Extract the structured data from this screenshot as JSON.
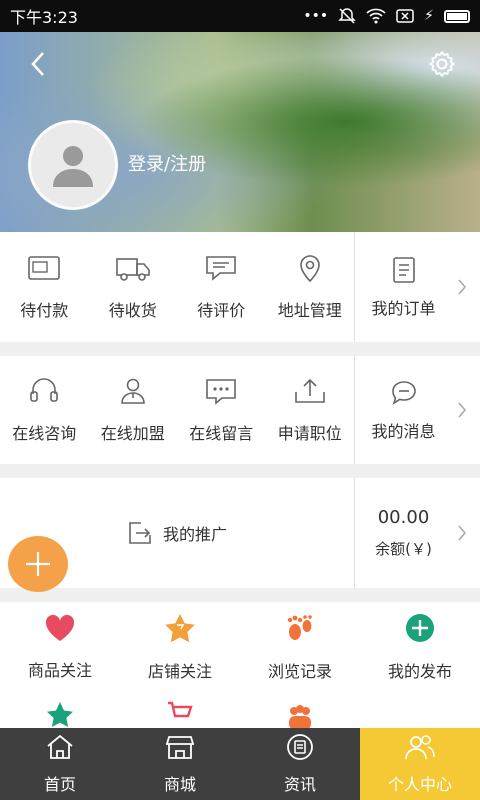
{
  "status_bar": {
    "time": "下午3:23"
  },
  "header": {
    "login_text": "登录/注册"
  },
  "orders": {
    "items": [
      {
        "label": "待付款",
        "icon": "wallet-icon"
      },
      {
        "label": "待收货",
        "icon": "truck-icon"
      },
      {
        "label": "待评价",
        "icon": "comment-icon"
      },
      {
        "label": "地址管理",
        "icon": "location-icon"
      }
    ],
    "side": {
      "label": "我的订单",
      "icon": "order-list-icon"
    }
  },
  "services": {
    "items": [
      {
        "label": "在线咨询",
        "icon": "headset-icon"
      },
      {
        "label": "在线加盟",
        "icon": "user-join-icon"
      },
      {
        "label": "在线留言",
        "icon": "message-dots-icon"
      },
      {
        "label": "申请职位",
        "icon": "upload-icon"
      }
    ],
    "side": {
      "label": "我的消息",
      "icon": "chat-bubble-icon"
    }
  },
  "promotion": {
    "label": "我的推广",
    "balance_value": "00.00",
    "balance_label": "余额(￥)"
  },
  "extras": {
    "items": [
      {
        "label": "商品关注",
        "icon": "heart-icon"
      },
      {
        "label": "店铺关注",
        "icon": "star-shop-icon"
      },
      {
        "label": "浏览记录",
        "icon": "footprint-icon"
      },
      {
        "label": "我的发布",
        "icon": "plus-circle-icon"
      }
    ]
  },
  "tabbar": {
    "tabs": [
      {
        "label": "首页",
        "icon": "home-icon"
      },
      {
        "label": "商城",
        "icon": "shop-icon"
      },
      {
        "label": "资讯",
        "icon": "news-icon"
      },
      {
        "label": "个人中心",
        "icon": "user-center-icon"
      }
    ],
    "active_index": 3
  },
  "colors": {
    "accent": "#f4c935",
    "fab": "#f5a14a",
    "heart": "#e84a5f",
    "star": "#f2a13a",
    "footprint": "#f2733a",
    "publish": "#1aa37a",
    "tabbar": "#3f3f3f"
  }
}
